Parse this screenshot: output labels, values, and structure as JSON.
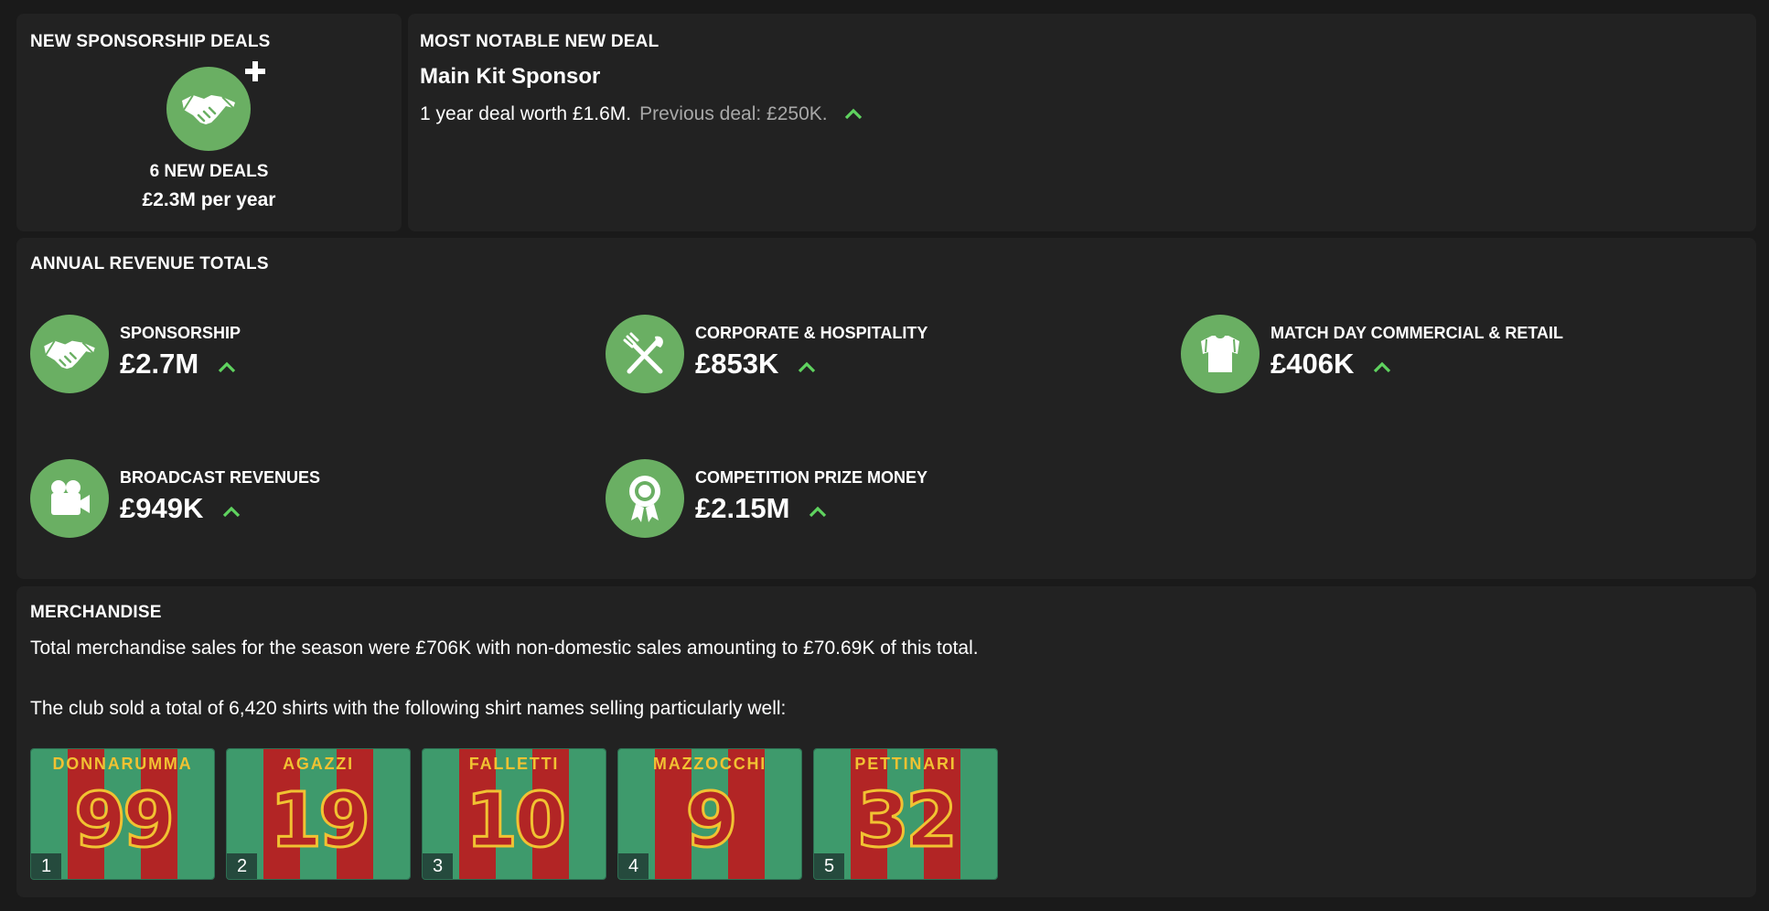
{
  "new_deals": {
    "title": "NEW SPONSORSHIP DEALS",
    "count_label": "6 NEW DEALS",
    "value_label": "£2.3M per year",
    "icon": "handshake-plus-icon"
  },
  "notable_deal": {
    "title": "MOST NOTABLE NEW DEAL",
    "name": "Main Kit Sponsor",
    "description": "1 year deal worth £1.6M.",
    "previous": "Previous deal: £250K.",
    "trend": "up"
  },
  "revenue": {
    "title": "ANNUAL REVENUE TOTALS",
    "items": [
      {
        "label": "SPONSORSHIP",
        "value": "£2.7M",
        "icon": "handshake-icon",
        "trend": "up"
      },
      {
        "label": "CORPORATE & HOSPITALITY",
        "value": "£853K",
        "icon": "cutlery-icon",
        "trend": "up"
      },
      {
        "label": "MATCH DAY COMMERCIAL & RETAIL",
        "value": "£406K",
        "icon": "shirt-icon",
        "trend": "up"
      },
      {
        "label": "BROADCAST REVENUES",
        "value": "£949K",
        "icon": "camera-icon",
        "trend": "up"
      },
      {
        "label": "COMPETITION PRIZE MONEY",
        "value": "£2.15M",
        "icon": "award-ribbon-icon",
        "trend": "up"
      }
    ]
  },
  "merchandise": {
    "title": "MERCHANDISE",
    "sales_text": "Total merchandise sales for the season were £706K with non-domestic sales amounting to £70.69K of this total.",
    "shirts_text": "The club sold a total of 6,420 shirts with the following shirt names selling particularly well:",
    "shirts": [
      {
        "name": "DONNARUMMA",
        "number": "99",
        "rank": "1"
      },
      {
        "name": "AGAZZI",
        "number": "19",
        "rank": "2"
      },
      {
        "name": "FALLETTI",
        "number": "10",
        "rank": "3"
      },
      {
        "name": "MAZZOCCHI",
        "number": "9",
        "rank": "4"
      },
      {
        "name": "PETTINARI",
        "number": "32",
        "rank": "5"
      }
    ]
  },
  "colors": {
    "panel_bg": "#222222",
    "page_bg": "#1a1a1a",
    "icon_green": "#6aaf63",
    "trend_green": "#5fd35f",
    "muted_text": "#a8a8a8",
    "shirt_green": "#3e9a6c",
    "shirt_red": "#b22525",
    "shirt_gold": "#f1c232"
  }
}
